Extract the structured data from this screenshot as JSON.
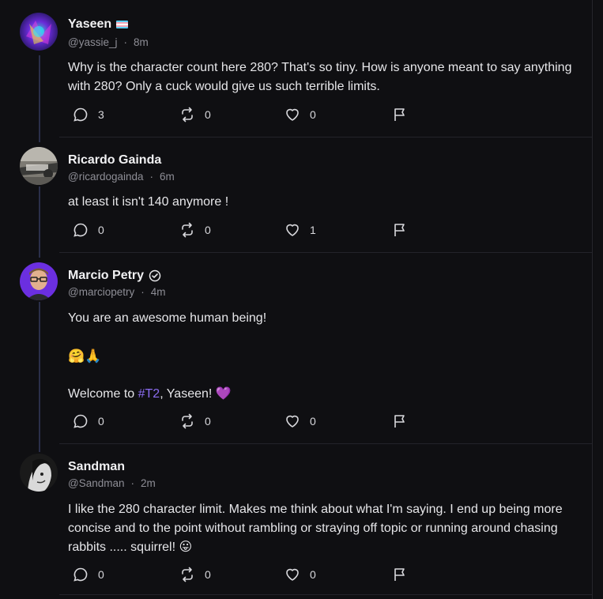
{
  "posts": [
    {
      "name": "Yaseen",
      "handle": "@yassie_j",
      "time": "8m",
      "body": [
        "Why is the character count here 280? That's so tiny. How is anyone meant to say anything with 280? Only a cuck would give us such terrible limits."
      ],
      "replies": "3",
      "reposts": "0",
      "likes": "0",
      "avatar_icon": "abstract-colorful-avatar",
      "badge_icon": "transgender-flag-icon"
    },
    {
      "name": "Ricardo Gainda",
      "handle": "@ricardogainda",
      "time": "6m",
      "body": [
        "at least it isn't 140 anymore !"
      ],
      "replies": "0",
      "reposts": "0",
      "likes": "1",
      "avatar_icon": "photo-avatar"
    },
    {
      "name": "Marcio Petry",
      "handle": "@marciopetry",
      "time": "4m",
      "body_line1": "You are an awesome human being!",
      "body_emoji": "🤗🙏",
      "body_welcome_pre": "Welcome to ",
      "body_hashtag": "#T2",
      "body_welcome_post": ", Yaseen! 💜",
      "replies": "0",
      "reposts": "0",
      "likes": "0",
      "avatar_icon": "person-with-glasses-avatar",
      "badge_icon": "verified-icon"
    },
    {
      "name": "Sandman",
      "handle": "@Sandman",
      "time": "2m",
      "body": [
        "I like the 280 character limit. Makes me think about what I'm saying. I end up being more concise and to the point without rambling or straying off topic or running around chasing rabbits ..... squirrel! 😛"
      ],
      "replies": "0",
      "reposts": "0",
      "likes": "0",
      "avatar_icon": "black-white-portrait-avatar"
    }
  ],
  "meta_separator": "·",
  "colors": {
    "background": "#0f0f12",
    "thread_line": "#2a2f4a",
    "hashtag": "#8b6cf0",
    "muted": "#8e8e96"
  }
}
